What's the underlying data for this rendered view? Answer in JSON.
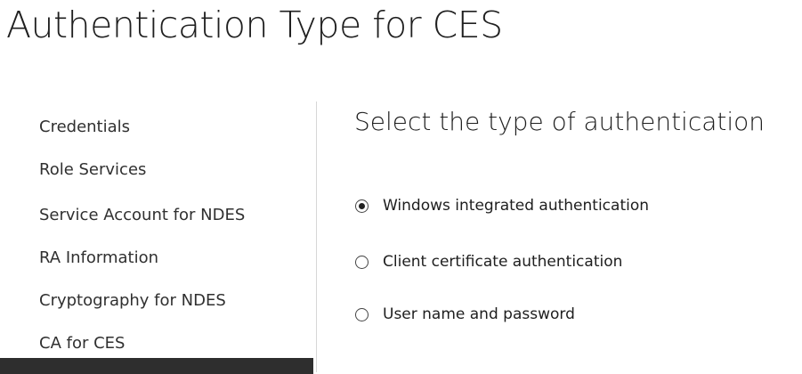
{
  "page": {
    "title": "Authentication Type for CES"
  },
  "sidebar": {
    "items": [
      {
        "label": "Credentials"
      },
      {
        "label": "Role Services"
      },
      {
        "label": "Service Account for NDES"
      },
      {
        "label": "RA Information"
      },
      {
        "label": "Cryptography for NDES"
      },
      {
        "label": "CA for CES"
      },
      {
        "label": "",
        "active": true
      }
    ]
  },
  "main": {
    "section_title": "Select the type of authentication",
    "options": [
      {
        "label": "Windows integrated authentication",
        "selected": true
      },
      {
        "label": "Client certificate authentication",
        "selected": false
      },
      {
        "label": "User name and password",
        "selected": false
      }
    ]
  }
}
